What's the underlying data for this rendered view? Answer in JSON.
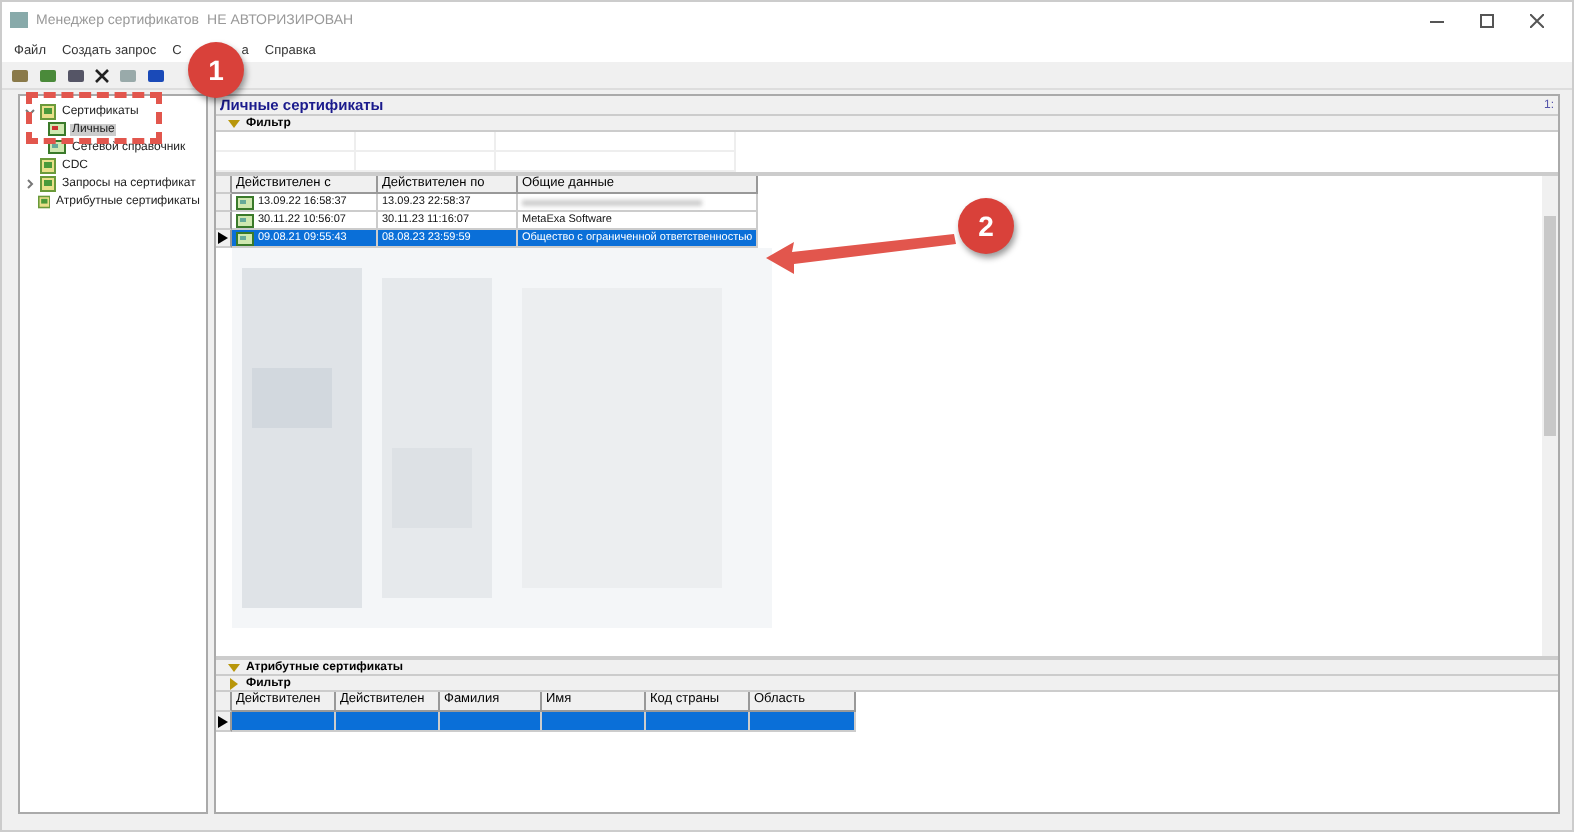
{
  "window": {
    "title": "Менеджер сертификатов",
    "status": "НЕ АВТОРИЗИРОВАН"
  },
  "menu": [
    "Файл",
    "Создать запрос",
    "С",
    "а",
    "Справка"
  ],
  "tree": [
    {
      "label": "Сертификаты",
      "expanded": true,
      "children": [
        {
          "label": "Личные",
          "selected": true
        },
        {
          "label": "Сетевой справочник",
          "selected": false
        }
      ]
    },
    {
      "label": "CDC"
    },
    {
      "label": "Запросы на сертификат",
      "expanded": false
    },
    {
      "label": "Атрибутные сертификаты"
    }
  ],
  "personal": {
    "title": "Личные сертификаты",
    "corner": "1:",
    "filter": "Фильтр",
    "columns": [
      "Действителен с",
      "Действителен по",
      "Общие данные"
    ],
    "rows": [
      {
        "from": "13.09.22 16:58:37",
        "to": "13.09.23 22:58:37",
        "selected": false
      },
      {
        "from": "30.11.22 10:56:07",
        "to": "30.11.23 11:16:07",
        "data": "MetaExa Software",
        "selected": false
      },
      {
        "from": "09.08.21 09:55:43",
        "to": "08.08.23 23:59:59",
        "data": "Общество с ограниченной ответственностью",
        "selected": true
      }
    ]
  },
  "attribute": {
    "title": "Атрибутные сертификаты",
    "filter": "Фильтр",
    "columns": [
      "Действителен",
      "Действителен",
      "Фамилия",
      "Имя",
      "Код страны",
      "Область"
    ]
  },
  "callouts": [
    "1",
    "2"
  ]
}
